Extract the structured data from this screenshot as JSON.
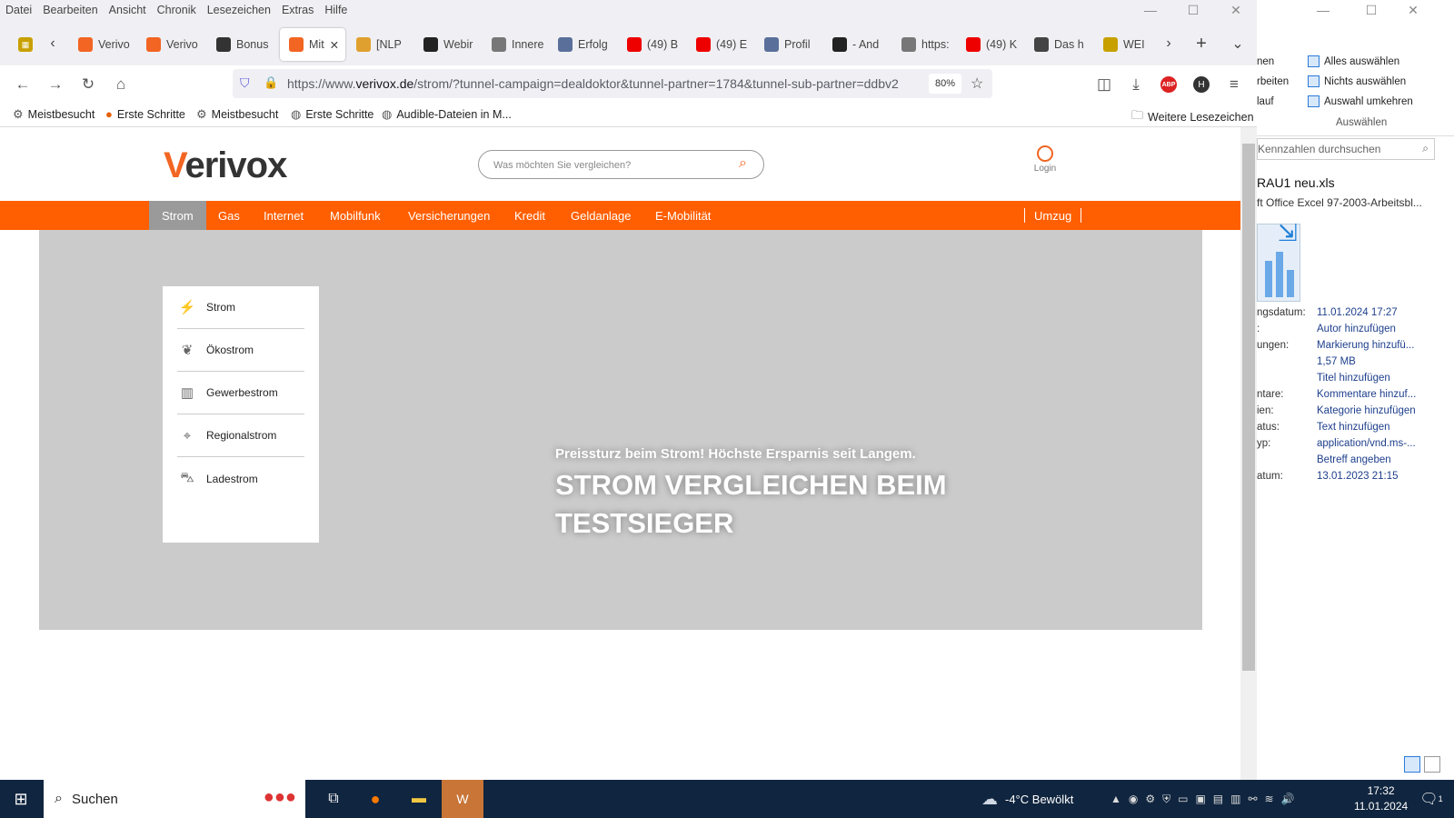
{
  "menubar": [
    "Datei",
    "Bearbeiten",
    "Ansicht",
    "Chronik",
    "Lesezeichen",
    "Extras",
    "Hilfe"
  ],
  "tabs": [
    {
      "label": "Verivo",
      "icon": "verivox-icon",
      "color": "#f26522"
    },
    {
      "label": "Verivo",
      "icon": "verivox-icon",
      "color": "#f26522"
    },
    {
      "label": "Bonus",
      "icon": "bonus-icon",
      "color": "#333"
    },
    {
      "label": "Mit",
      "icon": "verivox-icon",
      "color": "#f26522",
      "active": true
    },
    {
      "label": "[NLP",
      "icon": "nlp-icon",
      "color": "#e0a030"
    },
    {
      "label": "Webir",
      "icon": "graduation-cap-icon",
      "color": "#222"
    },
    {
      "label": "Innere",
      "icon": "figure-icon",
      "color": "#777"
    },
    {
      "label": "Erfolg",
      "icon": "doc-icon",
      "color": "#5a6f9a"
    },
    {
      "label": "(49) B",
      "icon": "youtube-icon",
      "color": "#e00"
    },
    {
      "label": "(49) E",
      "icon": "youtube-icon",
      "color": "#e00"
    },
    {
      "label": "Profil",
      "icon": "doc-icon",
      "color": "#5a6f9a"
    },
    {
      "label": "- And",
      "icon": "graduation-cap-icon",
      "color": "#222"
    },
    {
      "label": "https:",
      "icon": "link-icon",
      "color": "#777"
    },
    {
      "label": "(49) K",
      "icon": "youtube-icon",
      "color": "#e00"
    },
    {
      "label": "Das h",
      "icon": "globe-icon",
      "color": "#444"
    },
    {
      "label": "WEI",
      "icon": "bank-icon",
      "color": "#c8a000"
    }
  ],
  "url": {
    "prefix": "https://www.",
    "domain": "verivox.de",
    "rest": "/strom/?tunnel-campaign=dealdoktor&tunnel-partner=1784&tunnel-sub-partner=ddbv2"
  },
  "zoom": "80%",
  "bookmarks": [
    "Meistbesucht",
    "Erste Schritte",
    "Meistbesucht",
    "Erste Schritte",
    "Audible-Dateien in M..."
  ],
  "bookmarks_other": "Weitere Lesezeichen",
  "site": {
    "logo": "verivox",
    "search_placeholder": "Was möchten Sie vergleichen?",
    "login": "Login",
    "nav": [
      "Strom",
      "Gas",
      "Internet",
      "Mobilfunk",
      "Versicherungen",
      "Kredit",
      "Geldanlage",
      "E-Mobilität"
    ],
    "nav_right": "Umzug",
    "side_menu": [
      "Strom",
      "Ökostrom",
      "Gewerbestrom",
      "Regionalstrom",
      "Ladestrom"
    ],
    "hero_sub": "Preissturz beim Strom! Höchste Ersparnis seit Langem.",
    "hero_title": "STROM VERGLEICHEN BEIM TESTSIEGER"
  },
  "explorer": {
    "ribbon": [
      "Alles auswählen",
      "Nichts auswählen",
      "Auswahl umkehren"
    ],
    "ribbon_left": [
      "nen",
      "rbeiten",
      "lauf"
    ],
    "group": "Auswählen",
    "search": "Kennzahlen durchsuchen",
    "filename": "RAU1 neu.xls",
    "filetype": "ft Office Excel 97-2003-Arbeitsbl...",
    "props": [
      {
        "k": "ngsdatum:",
        "v": "11.01.2024 17:27"
      },
      {
        "k": ":",
        "v": "Autor hinzufügen"
      },
      {
        "k": "ungen:",
        "v": "Markierung hinzufü..."
      },
      {
        "k": "",
        "v": "1,57 MB"
      },
      {
        "k": "",
        "v": "Titel hinzufügen"
      },
      {
        "k": "ntare:",
        "v": "Kommentare hinzuf..."
      },
      {
        "k": "ien:",
        "v": "Kategorie hinzufügen"
      },
      {
        "k": "atus:",
        "v": "Text hinzufügen"
      },
      {
        "k": "yp:",
        "v": "application/vnd.ms-..."
      },
      {
        "k": "",
        "v": "Betreff angeben"
      },
      {
        "k": "atum:",
        "v": "13.01.2023 21:15"
      }
    ]
  },
  "taskbar": {
    "search": "Suchen",
    "weather": "-4°C",
    "weather_text": "Bewölkt",
    "time": "17:32",
    "date": "11.01.2024",
    "notif": "1"
  }
}
